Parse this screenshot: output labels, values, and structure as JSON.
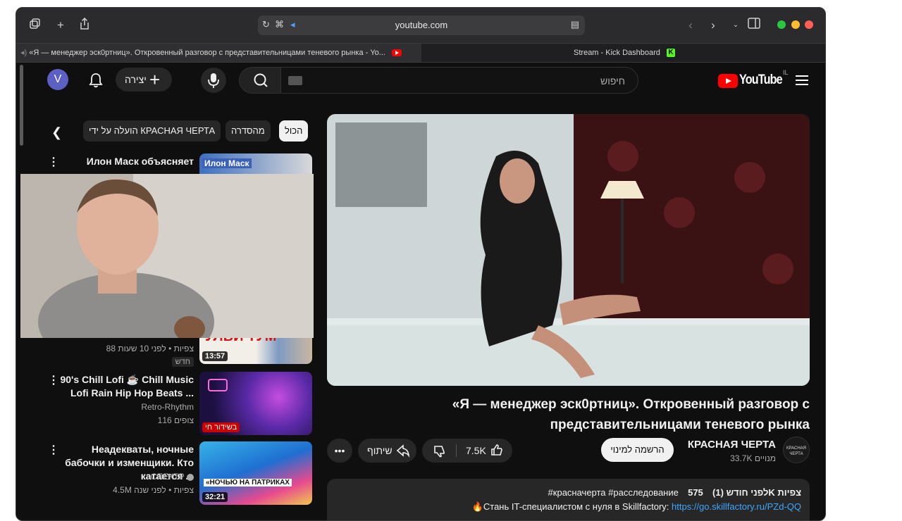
{
  "browser": {
    "address": "youtube.com",
    "tabs": [
      {
        "title": "«Я — менеджер эск0ртниц». Откровенный разговор с представительницами теневого рынка - Yo..."
      },
      {
        "title": "Stream - Kick Dashboard"
      }
    ],
    "traffic_colors": {
      "green": "#28c840",
      "yellow": "#febc2e",
      "red": "#ff5f57"
    }
  },
  "header": {
    "avatar_letter": "V",
    "create_label": "יצירה",
    "search_placeholder": "חיפוש",
    "logo_text": "YouTube",
    "country_code": "IL"
  },
  "chips": {
    "all": "הכול",
    "series": "מהסדרה",
    "uploaded_by": "הועלה על ידי",
    "channel": "КРАСНАЯ ЧЕРТА"
  },
  "sidebar": {
    "items": [
      {
        "title": "Илон Маск объясняет",
        "thumb_label": "Илон Маск"
      },
      {
        "meta": "88 צפיות • לפני 10 שעות",
        "badge": "חדש",
        "duration": "13:57",
        "thumb_text": "УЛВИ ТУМ"
      },
      {
        "title": "90's Chill Lofi ☕ Chill Music Lofi Rain Hip Hop Beats ...",
        "channel": "Retro-Rhythm",
        "meta": "116 צופים",
        "live": "בשידור חי"
      },
      {
        "title": "Неадекваты, ночные бабочки и изменщики. Кто катается ...",
        "channel": "СПЕКТР",
        "meta": "4.5M צפיות • לפני שנה",
        "duration": "32:21",
        "thumb_text": "«НОЧЬЮ НА ПАТРИКАХ"
      }
    ]
  },
  "video": {
    "title": "«Я — менеджер эск0ртниц». Откровенный разговор с представительницами теневого рынка",
    "likes": "7.5K",
    "share_label": "שיתוף",
    "subscribe_label": "הרשמה למינוי",
    "channel_name": "КРАСНАЯ ЧЕРТА",
    "channel_subs": "33.7K מנויים",
    "channel_avatar_text": "КРАСНАЯ ЧЕРТА",
    "description": {
      "views": "575K צפיות",
      "date": "לפני חודש (1)",
      "hashtags": "#красначерта #расследование",
      "line2_text": "🔥Стань IT-специалистом с нуля в Skillfactory: ",
      "line2_link": "https://go.skillfactory.ru/PZd-QQ"
    }
  }
}
